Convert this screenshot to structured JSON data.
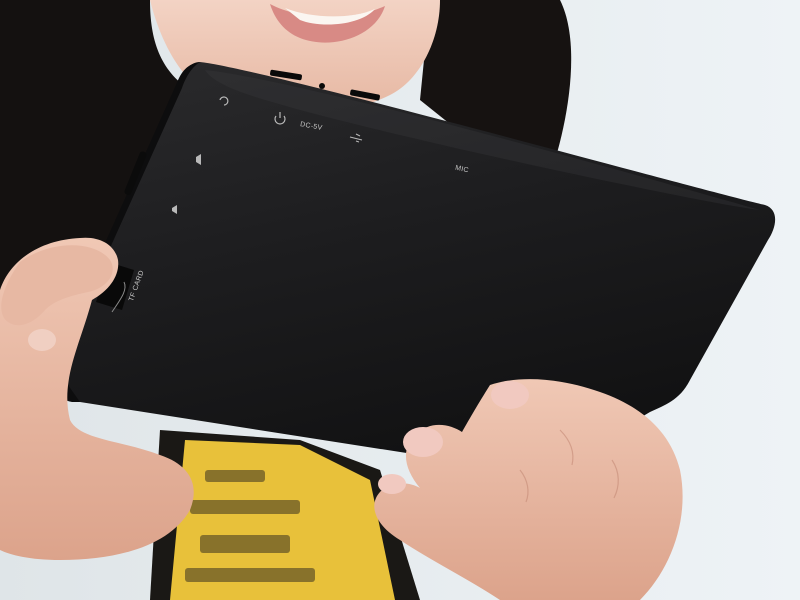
{
  "photo": {
    "background_color": "#e9eef1",
    "tablet_color": "#1c1c1e",
    "skin_color": "#e7b8a3",
    "shirt_color": "#e8c13a",
    "hair_color": "#141110"
  },
  "tablet": {
    "labels": {
      "dc": "DC-5V",
      "mic": "MIC",
      "card": "TF CARD"
    },
    "icons": [
      "power-icon",
      "usb-icon",
      "headphone-icon",
      "speaker-icon",
      "volume-plus-icon",
      "volume-minus-icon"
    ]
  }
}
